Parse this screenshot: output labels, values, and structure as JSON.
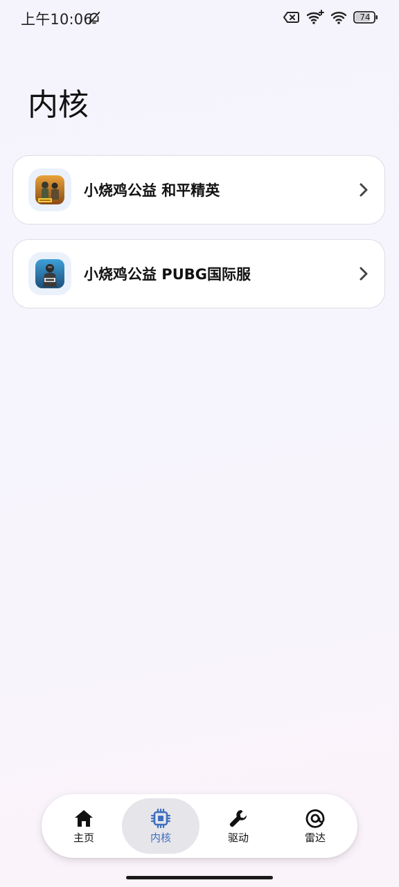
{
  "status_bar": {
    "time": "上午10:06",
    "battery": "74",
    "icons": [
      "bell-off-icon",
      "sim-error-icon",
      "wifi-plus-icon",
      "wifi-icon",
      "battery-icon"
    ]
  },
  "page": {
    "title": "内核"
  },
  "items": [
    {
      "label": "小烧鸡公益 和平精英",
      "icon": "peace-elite-app-icon"
    },
    {
      "label": "小烧鸡公益 PUBG国际服",
      "icon": "pubg-app-icon"
    }
  ],
  "nav": {
    "active": "内核",
    "items": [
      {
        "label": "主页",
        "icon": "home-icon"
      },
      {
        "label": "内核",
        "icon": "chip-icon"
      },
      {
        "label": "驱动",
        "icon": "wrench-icon"
      },
      {
        "label": "雷达",
        "icon": "radar-icon"
      }
    ]
  },
  "colors": {
    "accent": "#3d6fbf",
    "active_pill": "#e6e5ea",
    "background": "#f5f4fd",
    "card_border": "#dedde7"
  }
}
